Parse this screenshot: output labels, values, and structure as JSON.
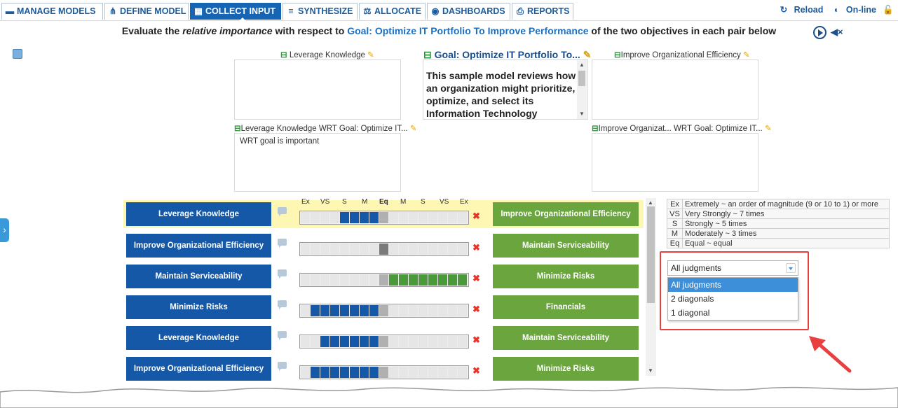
{
  "nav": {
    "tabs": [
      {
        "label": "MANAGE MODELS",
        "icon": "folder-icon"
      },
      {
        "label": "DEFINE MODEL",
        "icon": "hierarchy-icon"
      },
      {
        "label": "COLLECT INPUT",
        "icon": "keyboard-icon"
      },
      {
        "label": "SYNTHESIZE",
        "icon": "chart-icon"
      },
      {
        "label": "ALLOCATE",
        "icon": "scale-icon"
      },
      {
        "label": "DASHBOARDS",
        "icon": "dashboard-icon"
      },
      {
        "label": "REPORTS",
        "icon": "printer-icon"
      }
    ],
    "active_tab": "COLLECT INPUT",
    "reload_label": "Reload",
    "online_label": "On-line"
  },
  "instruction": {
    "part1": "Evaluate the ",
    "emphasis": "relative importance",
    "part2": " with respect to ",
    "goal": "Goal: Optimize IT Portfolio To Improve Performance",
    "part3": " of the two objectives in each pair below"
  },
  "panes": {
    "left_title": "Leverage Knowledge",
    "goal_title": "Goal: Optimize IT Portfolio To...",
    "goal_text": "This sample model reviews how an organization might prioritize, optimize, and select its Information Technology",
    "right_title": "Improve Organizational Efficiency",
    "left_wrt_title": "Leverage Knowledge WRT Goal: Optimize IT...",
    "left_wrt_text": "WRT goal is important",
    "right_wrt_title": "Improve Organizat... WRT Goal: Optimize IT..."
  },
  "scale_header": [
    "Ex",
    "VS",
    "S",
    "M",
    "Eq",
    "M",
    "S",
    "VS",
    "Ex"
  ],
  "comparisons": [
    {
      "left": "Leverage Knowledge",
      "right": "Improve Organizational Efficiency",
      "judgment": 4,
      "favors": "left",
      "highlighted": true
    },
    {
      "left": "Improve Organizational Efficiency",
      "right": "Maintain Serviceability",
      "judgment": 0,
      "favors": "equal",
      "highlighted": false
    },
    {
      "left": "Maintain Serviceability",
      "right": "Minimize Risks",
      "judgment": 8,
      "favors": "right",
      "highlighted": false
    },
    {
      "left": "Minimize Risks",
      "right": "Financials",
      "judgment": 7,
      "favors": "left",
      "highlighted": false
    },
    {
      "left": "Leverage Knowledge",
      "right": "Maintain Serviceability",
      "judgment": 6,
      "favors": "left",
      "highlighted": false
    },
    {
      "left": "Improve Organizational Efficiency",
      "right": "Minimize Risks",
      "judgment": 7,
      "favors": "left",
      "highlighted": false
    }
  ],
  "legend": [
    {
      "abbr": "Ex",
      "text": "Extremely ~ an order of magnitude (9 or 10 to 1) or more"
    },
    {
      "abbr": "VS",
      "text": "Very Strongly ~ 7 times"
    },
    {
      "abbr": "S",
      "text": "Strongly ~ 5 times"
    },
    {
      "abbr": "M",
      "text": "Moderately ~ 3 times"
    },
    {
      "abbr": "Eq",
      "text": "Equal ~ equal"
    }
  ],
  "dropdown": {
    "selected": "All judgments",
    "options": [
      "All judgments",
      "2 diagonals",
      "1 diagonal"
    ]
  },
  "colors": {
    "left_objective": "#1558a8",
    "right_objective": "#6aa63d",
    "highlight_row": "#fdf7b3",
    "annotation_red": "#e84040"
  }
}
